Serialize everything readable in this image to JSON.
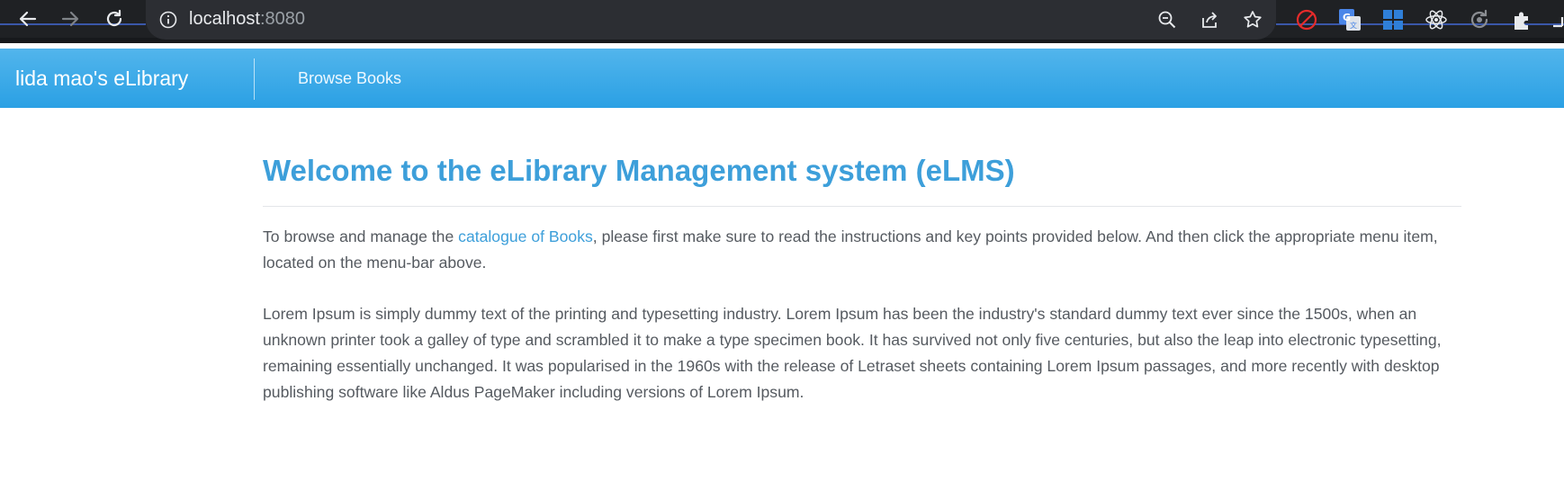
{
  "browser": {
    "url_host": "localhost",
    "url_port": ":8080",
    "toolbar_icons": [
      "back-icon",
      "forward-icon",
      "reload-icon",
      "site-info-icon",
      "zoom-out-icon",
      "share-icon",
      "bookmark-star-icon"
    ],
    "extensions": [
      "blocker-extension-icon",
      "translate-extension-icon",
      "windows-extension-icon",
      "react-devtools-icon",
      "sync-extension-icon",
      "extensions-puzzle-icon"
    ]
  },
  "navbar": {
    "brand": "lida mao's eLibrary",
    "links": [
      {
        "label": "Browse Books"
      }
    ],
    "accent_color": "#2aa0e4"
  },
  "main": {
    "title": "Welcome to the eLibrary Management system (eLMS)",
    "intro": {
      "before_link": "To browse and manage the ",
      "link_text": "catalogue of Books",
      "after_link": ", please first make sure to read the instructions and key points provided below. And then click the appropriate menu item, located on the menu-bar above."
    },
    "body": "Lorem Ipsum is simply dummy text of the printing and typesetting industry. Lorem Ipsum has been the industry's standard dummy text ever since the 1500s, when an unknown printer took a galley of type and scrambled it to make a type specimen book. It has survived not only five centuries, but also the leap into electronic typesetting, remaining essentially unchanged. It was popularised in the 1960s with the release of Letraset sheets containing Lorem Ipsum passages, and more recently with desktop publishing software like Aldus PageMaker including versions of Lorem Ipsum.",
    "title_color": "#3d9fda",
    "text_color": "#555a60"
  }
}
